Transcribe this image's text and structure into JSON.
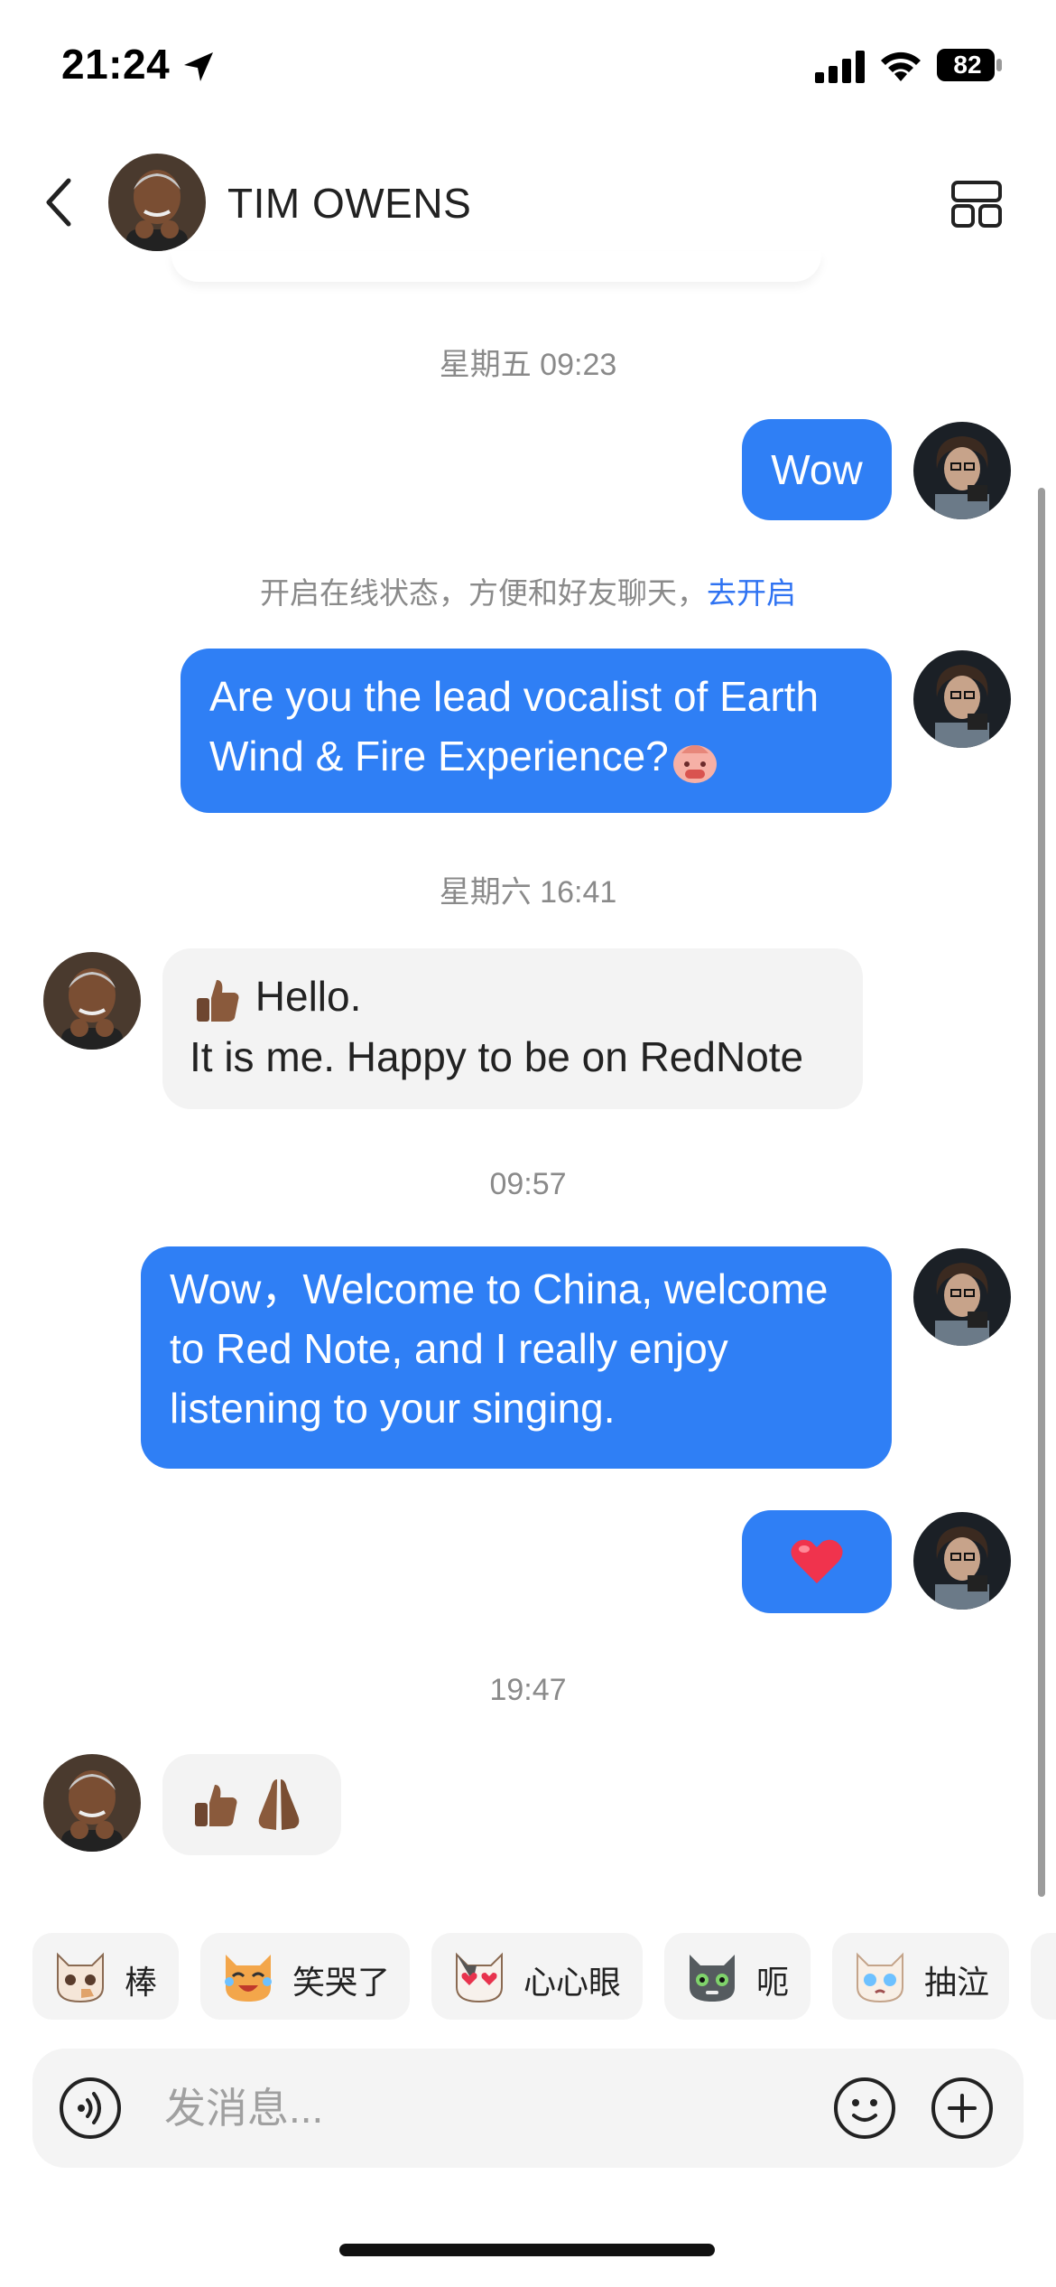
{
  "status_bar": {
    "time": "21:24",
    "battery": "82",
    "icons": [
      "location-arrow-icon",
      "signal-icon",
      "wifi-icon",
      "battery-icon"
    ]
  },
  "header": {
    "title": "TIM OWENS",
    "icons": [
      "back-icon",
      "layout-icon"
    ]
  },
  "chat": {
    "timestamps": [
      "星期五 09:23",
      "星期六 16:41",
      "09:57",
      "19:47"
    ],
    "notice": {
      "text": "开启在线状态，方便和好友聊天，",
      "link": "去开启"
    },
    "messages": [
      {
        "from": "me",
        "text": "Wow"
      },
      {
        "from": "me",
        "text": "Are you the lead vocalist of Earth\nWind & Fire Experience?",
        "emoji": "bashful-peach-emoji"
      },
      {
        "from": "them",
        "line1": "Hello.",
        "line2": "It is me. Happy to be on RedNote",
        "emoji": "thumbs-up-emoji"
      },
      {
        "from": "me",
        "text": "Wow，Welcome to China, welcome\nto Red Note, and I really enjoy\nlistening to your singing."
      },
      {
        "from": "me",
        "emoji": "heart-emoji"
      },
      {
        "from": "them",
        "emoji": [
          "thumbs-up-emoji",
          "folded-hands-emoji"
        ]
      }
    ]
  },
  "stickers": [
    {
      "label": "棒",
      "icon": "cat-thumbs-sticker"
    },
    {
      "label": "笑哭了",
      "icon": "cat-laugh-cry-sticker"
    },
    {
      "label": "心心眼",
      "icon": "cat-heart-eyes-sticker"
    },
    {
      "label": "呃",
      "icon": "cat-awkward-sticker"
    },
    {
      "label": "抽泣",
      "icon": "cat-sob-sticker"
    }
  ],
  "input": {
    "placeholder": "发消息..."
  },
  "colors": {
    "accent": "#2f7ff5",
    "link": "#2f73f2",
    "bubble_them": "#f3f3f3",
    "muted_text": "#8a8a8a"
  }
}
